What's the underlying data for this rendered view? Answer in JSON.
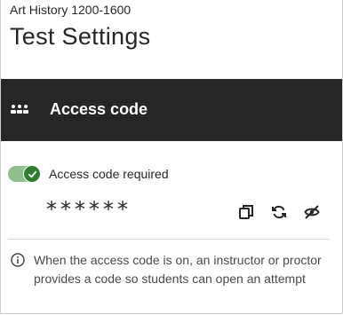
{
  "course_title": "Art History 1200-1600",
  "page_title": "Test Settings",
  "section": {
    "title": "Access code",
    "icon": "dots-icon"
  },
  "access_code": {
    "toggle_label": "Access code required",
    "enabled": true,
    "masked_value": "******",
    "actions": [
      "copy-icon",
      "refresh-icon",
      "eye-off-icon"
    ]
  },
  "info": {
    "icon": "info-icon",
    "text": "When the access code is on, an instructor or proctor provides a code so students can open an attempt"
  },
  "colors": {
    "header_bg": "#262626",
    "toggle_on": "#2e7d32",
    "toggle_track": "#8fbf8c"
  }
}
